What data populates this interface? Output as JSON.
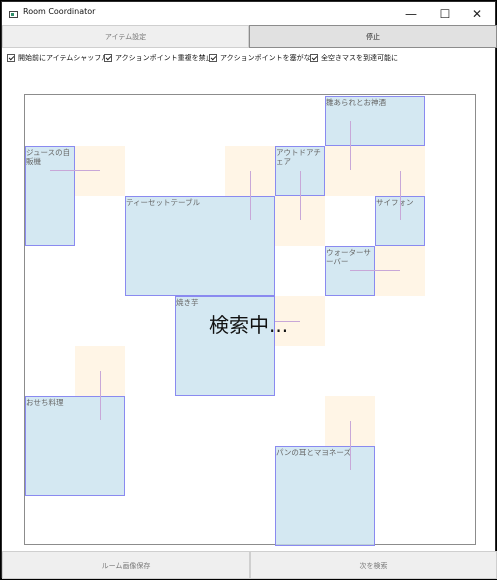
{
  "window": {
    "title": "Room Coordinator",
    "minimize": "—",
    "maximize": "☐",
    "close": "✕"
  },
  "tabs": {
    "items": "アイテム設定",
    "stop": "停止"
  },
  "options": [
    {
      "label": "開始前にアイテムシャッフル",
      "checked": true
    },
    {
      "label": "アクションポイント重複を禁止",
      "checked": true
    },
    {
      "label": "アクションポイントを塞がない",
      "checked": true
    },
    {
      "label": "全空きマスを到達可能に",
      "checked": true
    }
  ],
  "items": {
    "juice": "ジュースの自販機",
    "tea": "ティーセットテーブル",
    "yakiimo": "焼き芋",
    "outdoor": "アウトドアチェア",
    "hinamatsuri": "雛あられとお神酒",
    "siphon": "サイフォン",
    "water": "ウォーターサーバー",
    "osechi": "おせち料理",
    "pan": "パンの耳とマヨネーズ"
  },
  "status": {
    "searching": "検索中..."
  },
  "footer": {
    "save": "ルーム画像保存",
    "next": "次を検索"
  },
  "colors": {
    "item_fill": "#c8e1ee",
    "item_border": "#8a8af0",
    "action_zone": "#fff5e6",
    "action_line": "#c8a7d8"
  }
}
